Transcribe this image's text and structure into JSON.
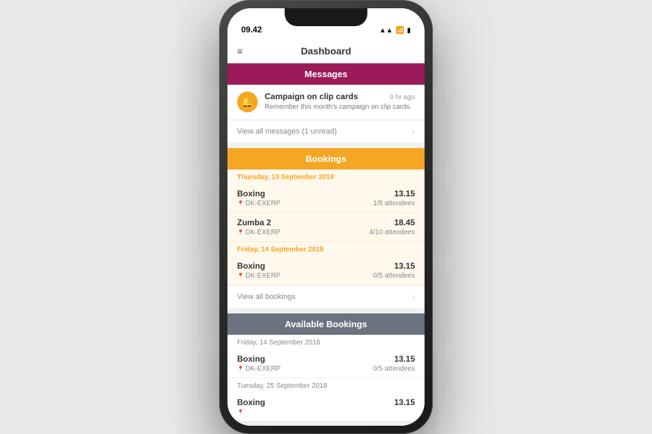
{
  "status_bar": {
    "time": "09.42",
    "icons": "▲▲ WiFi Battery"
  },
  "nav": {
    "title": "Dashboard",
    "menu_icon": "≡"
  },
  "messages_section": {
    "header": "Messages",
    "item": {
      "title": "Campaign on clip cards",
      "time": "9 hr ago",
      "preview": "Remember this month's campaign on clip cards.",
      "icon": "🔔"
    },
    "view_all": "View all messages (1 unread)"
  },
  "bookings_section": {
    "header": "Bookings",
    "date1": "Thursday, 13 September 2018",
    "items1": [
      {
        "name": "Boxing",
        "location": "DK-EXERP",
        "time": "13.15",
        "attendees": "1/5 attendees"
      },
      {
        "name": "Zumba 2",
        "location": "DK-EXERP",
        "time": "18.45",
        "attendees": "4/10 attendees"
      }
    ],
    "date2": "Friday, 14 September 2018",
    "items2": [
      {
        "name": "Boxing",
        "location": "DK-EXERP",
        "time": "13.15",
        "attendees": "0/5 attendees"
      }
    ],
    "view_all": "View all bookings"
  },
  "available_section": {
    "header": "Available Bookings",
    "date1": "Friday, 14 September 2018",
    "items1": [
      {
        "name": "Boxing",
        "location": "DK-EXERP",
        "time": "13.15",
        "attendees": "0/5 attendees"
      }
    ],
    "date2": "Tuesday, 25 September 2018",
    "items2": [
      {
        "name": "Boxing",
        "location": "",
        "time": "13.15",
        "attendees": ""
      }
    ]
  },
  "colors": {
    "messages_header": "#9b1b5a",
    "bookings_header": "#f5a623",
    "available_header": "#6b7280",
    "date_color": "#f5a623"
  }
}
